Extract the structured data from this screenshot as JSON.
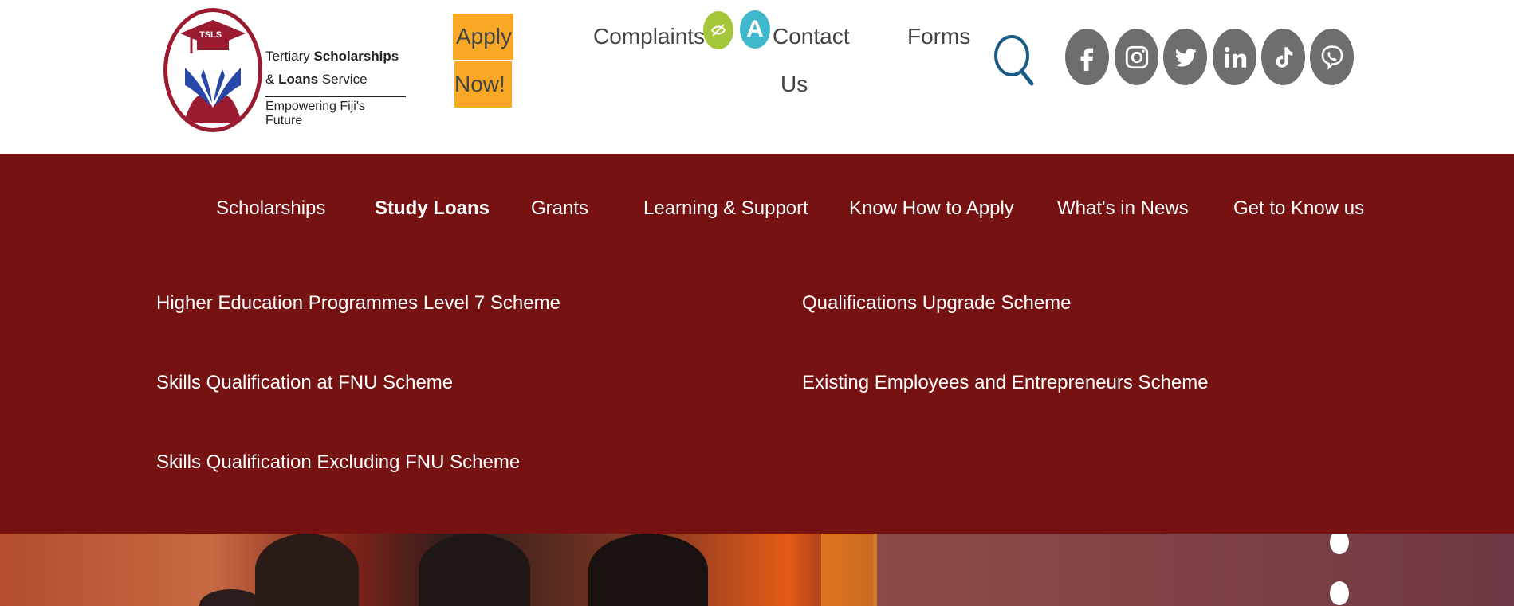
{
  "logo": {
    "badge": "TSLS",
    "line1_regular": "Tertiary ",
    "line1_bold": "Scholarships",
    "line2_regular1": "& ",
    "line2_bold": "Loans",
    "line2_regular2": " Service",
    "tagline": "Empowering Fiji's Future"
  },
  "topbar": {
    "apply_line1": "Apply",
    "apply_line2": "Now!",
    "complaints": "Complaints",
    "contact_line1": "Contact",
    "contact_line2": "Us",
    "forms": "Forms",
    "accessibility_a": "A"
  },
  "social": [
    "facebook-icon",
    "instagram-icon",
    "twitter-icon",
    "linkedin-icon",
    "tiktok-icon",
    "viber-icon"
  ],
  "main_nav": [
    {
      "label": "Scholarships",
      "active": false
    },
    {
      "label": "Study Loans",
      "active": true
    },
    {
      "label": "Grants",
      "active": false
    },
    {
      "label": "Learning & Support",
      "active": false
    },
    {
      "label": "Know How to Apply",
      "active": false
    },
    {
      "label": "What's in News",
      "active": false
    },
    {
      "label": "Get to Know us",
      "active": false
    }
  ],
  "sub_menu": {
    "left": [
      "Higher Education Programmes Level 7 Scheme",
      "Skills Qualification at FNU Scheme",
      "Skills Qualification Excluding FNU Scheme"
    ],
    "right": [
      "Qualifications Upgrade Scheme",
      "Existing Employees and Entrepreneurs Scheme"
    ]
  },
  "colors": {
    "brand": "#761212",
    "apply_bg": "#f9a825",
    "accessibility_green": "#a4c639",
    "accessibility_teal": "#3fb8cc",
    "social_bg": "#6e6e6e"
  }
}
